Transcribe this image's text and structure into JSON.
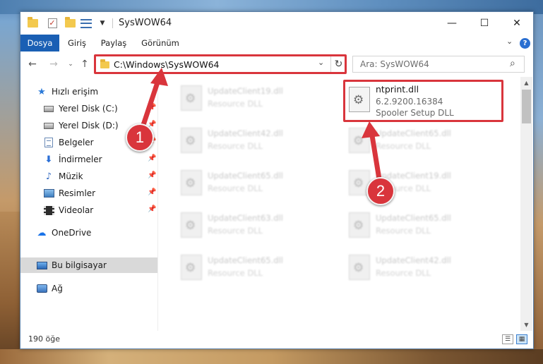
{
  "window": {
    "title": "SysWOW64"
  },
  "window_controls": {
    "minimize": "—",
    "maximize": "☐",
    "close": "✕"
  },
  "ribbon": {
    "tabs": [
      {
        "label": "Dosya",
        "active": true
      },
      {
        "label": "Giriş",
        "active": false
      },
      {
        "label": "Paylaş",
        "active": false
      },
      {
        "label": "Görünüm",
        "active": false
      }
    ],
    "help": "?"
  },
  "address": {
    "path": "C:\\Windows\\SysWOW64"
  },
  "search": {
    "placeholder": "Ara: SysWOW64"
  },
  "sidebar": {
    "items": [
      {
        "label": "Hızlı erişim",
        "icon": "star-icon"
      },
      {
        "label": "Yerel Disk (C:)",
        "icon": "drive-icon",
        "pinned": true
      },
      {
        "label": "Yerel Disk (D:)",
        "icon": "drive-icon",
        "pinned": true
      },
      {
        "label": "Belgeler",
        "icon": "documents-icon",
        "pinned": true
      },
      {
        "label": "İndirmeler",
        "icon": "download-icon",
        "pinned": true
      },
      {
        "label": "Müzik",
        "icon": "music-icon",
        "pinned": true
      },
      {
        "label": "Resimler",
        "icon": "pictures-icon",
        "pinned": true
      },
      {
        "label": "Videolar",
        "icon": "videos-icon",
        "pinned": true
      },
      {
        "label": "OneDrive",
        "icon": "cloud-icon"
      },
      {
        "label": "Bu bilgisayar",
        "icon": "computer-icon",
        "selected": true
      },
      {
        "label": "Ağ",
        "icon": "network-icon"
      }
    ]
  },
  "files": {
    "left": [
      {
        "name": "UpdateClient19.dll",
        "desc": "Resource DLL"
      },
      {
        "name": "UpdateClient42.dll",
        "desc": "Resource DLL"
      },
      {
        "name": "UpdateClient65.dll",
        "desc": "Resource DLL"
      },
      {
        "name": "UpdateClient63.dll",
        "desc": "Resource DLL"
      },
      {
        "name": "UpdateClient65.dll",
        "desc": "Resource DLL"
      }
    ],
    "right": [
      {
        "name": "UpdateClient65.dll",
        "desc": "Resource DLL"
      },
      {
        "name": "UpdateClient19.dll",
        "desc": "Resource DLL"
      },
      {
        "name": "UpdateClient65.dll",
        "desc": "Resource DLL"
      },
      {
        "name": "UpdateClient42.dll",
        "desc": "Resource DLL"
      }
    ],
    "highlighted": {
      "name": "ntprint.dll",
      "version": "6.2.9200.16384",
      "desc": "Spooler Setup DLL"
    }
  },
  "status": {
    "count": "190 öğe"
  },
  "annotations": {
    "badge1": "1",
    "badge2": "2",
    "color": "#d9353c"
  }
}
